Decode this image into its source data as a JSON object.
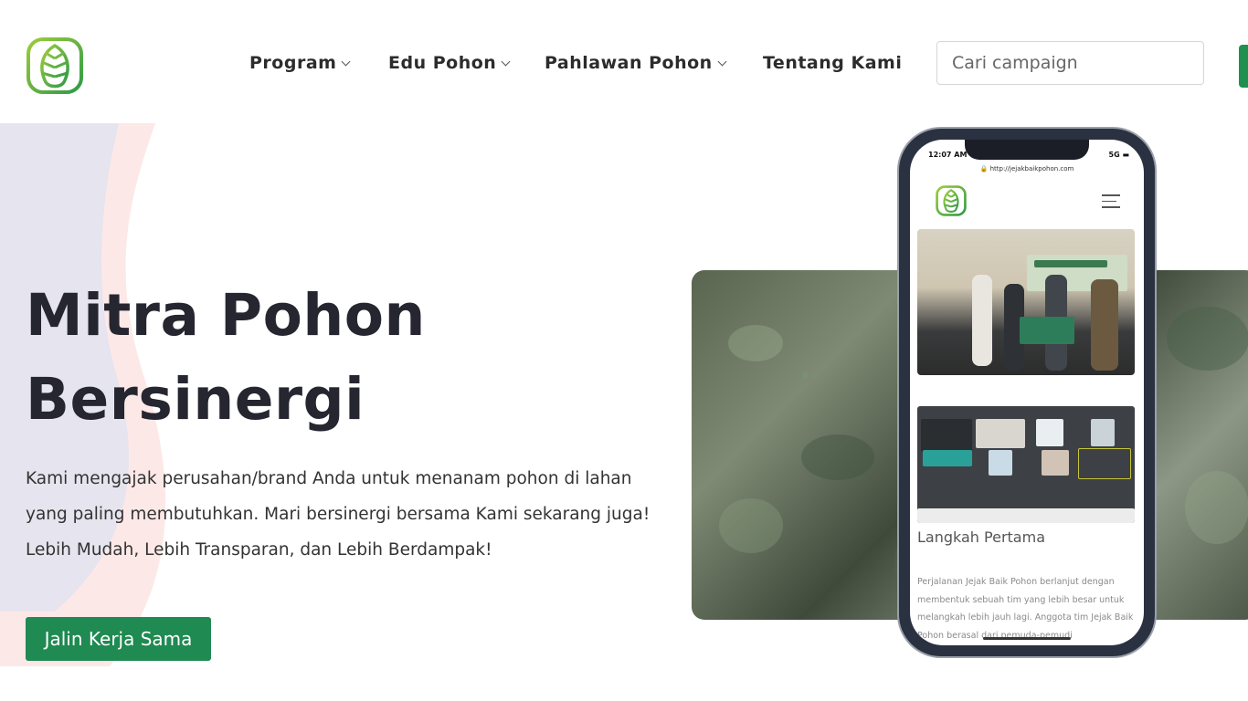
{
  "header": {
    "nav": [
      {
        "label": "Program",
        "dropdown": true
      },
      {
        "label": "Edu Pohon",
        "dropdown": true
      },
      {
        "label": "Pahlawan Pohon",
        "dropdown": true
      },
      {
        "label": "Tentang Kami",
        "dropdown": false
      }
    ],
    "search": {
      "placeholder": "Cari campaign",
      "value": ""
    }
  },
  "hero": {
    "title_line1": "Mitra Pohon",
    "title_line2": "Bersinergi",
    "description": "Kami mengajak perusahan/brand Anda untuk menanam pohon di lahan yang paling membutuhkan. Mari bersinergi bersama Kami sekarang juga! Lebih Mudah, Lebih Transparan, dan Lebih Berdampak!",
    "cta_label": "Jalin Kerja Sama"
  },
  "phone": {
    "time": "12:07 AM",
    "signal": "5G",
    "url": "http://jejakbaikpohon.com",
    "section_heading": "Langkah Pertama",
    "section_text": "Perjalanan Jejak Baik Pohon berlanjut dengan membentuk sebuah tim yang lebih besar untuk melangkah lebih jauh lagi. Anggota tim Jejak Baik Pohon berasal dari pemuda-pemudi"
  },
  "colors": {
    "brand_green": "#1f8a51",
    "logo_green": "#6ab23c",
    "title_dark": "#262630"
  },
  "icons": [
    "leaf-logo-icon",
    "chevron-down-icon",
    "hamburger-menu-icon",
    "lock-icon"
  ]
}
